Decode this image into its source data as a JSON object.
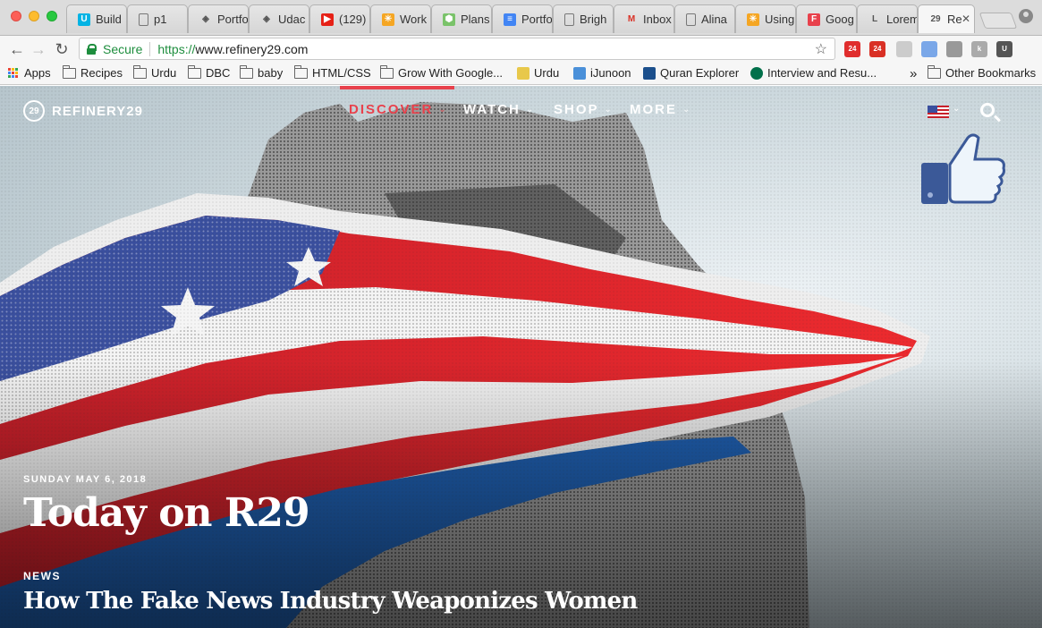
{
  "browser": {
    "tabs": [
      {
        "title": "Build",
        "icon": "udacity-icon",
        "color": "#02b3e4",
        "glyph": "U"
      },
      {
        "title": "p1",
        "icon": "page-icon",
        "color": "#ffffff",
        "glyph": ""
      },
      {
        "title": "Portfo",
        "icon": "codepen-icon",
        "color": "#ffffff",
        "glyph": "◈"
      },
      {
        "title": "Udac",
        "icon": "codepen-icon",
        "color": "#ffffff",
        "glyph": "◈"
      },
      {
        "title": "(129)",
        "icon": "youtube-icon",
        "color": "#e62117",
        "glyph": "▶"
      },
      {
        "title": "Work",
        "icon": "asterisk-icon",
        "color": "#f5a623",
        "glyph": "✳"
      },
      {
        "title": "Plans",
        "icon": "cube-icon",
        "color": "#7ac36a",
        "glyph": "⬢"
      },
      {
        "title": "Portfo",
        "icon": "docs-icon",
        "color": "#4285f4",
        "glyph": "≡"
      },
      {
        "title": "Brigh",
        "icon": "page-icon",
        "color": "#ffffff",
        "glyph": ""
      },
      {
        "title": "Inbox",
        "icon": "gmail-icon",
        "color": "#ffffff",
        "glyph": "M"
      },
      {
        "title": "Alina",
        "icon": "page-icon",
        "color": "#ffffff",
        "glyph": ""
      },
      {
        "title": "Using",
        "icon": "asterisk-icon",
        "color": "#f5a623",
        "glyph": "✳"
      },
      {
        "title": "Goog",
        "icon": "f-icon",
        "color": "#e8414c",
        "glyph": "F"
      },
      {
        "title": "Lorem",
        "icon": "l-icon",
        "color": "#ffffff",
        "glyph": "L"
      },
      {
        "title": "Re",
        "icon": "r29-icon",
        "color": "#ffffff",
        "glyph": "29",
        "active": true
      }
    ],
    "close_glyph": "✕",
    "back_glyph": "←",
    "forward_glyph": "→",
    "reload_glyph": "↻",
    "secure_label": "Secure",
    "url_scheme": "https://",
    "url_rest": "www.refinery29.com",
    "star_glyph": "☆",
    "extensions": [
      {
        "icon": "pinterest-badge-icon",
        "color": "#e02d2d",
        "badge": "24"
      },
      {
        "icon": "adblock-badge-icon",
        "color": "#d93025",
        "badge": "24"
      },
      {
        "icon": "feather-icon",
        "color": "#cccccc",
        "badge": ""
      },
      {
        "icon": "docs-ext-icon",
        "color": "#7aa7e8",
        "badge": ""
      },
      {
        "icon": "barcode-icon",
        "color": "#999999",
        "badge": ""
      },
      {
        "icon": "k-ext-icon",
        "color": "#aaaaaa",
        "badge": "k"
      },
      {
        "icon": "udacity-ext-icon",
        "color": "#555555",
        "badge": "U"
      }
    ]
  },
  "bookmarks": {
    "apps_label": "Apps",
    "items": [
      {
        "label": "Recipes",
        "icon": "folder-icon"
      },
      {
        "label": "Urdu",
        "icon": "folder-icon"
      },
      {
        "label": "DBC",
        "icon": "folder-icon"
      },
      {
        "label": "baby",
        "icon": "folder-icon"
      },
      {
        "label": "HTML/CSS",
        "icon": "folder-icon"
      },
      {
        "label": "Grow With Google...",
        "icon": "folder-icon"
      },
      {
        "label": "Urdu",
        "icon": "pen-icon"
      },
      {
        "label": "iJunoon",
        "icon": "ijunoon-icon"
      },
      {
        "label": "Quran Explorer",
        "icon": "quran-icon"
      },
      {
        "label": "Interview and Resu...",
        "icon": "starbucks-icon"
      }
    ],
    "overflow_glyph": "»",
    "other_label": "Other Bookmarks"
  },
  "site": {
    "logo_mark": "29",
    "logo_text": "REFINERY29",
    "nav": [
      {
        "label": "DISCOVER",
        "active": true
      },
      {
        "label": "WATCH",
        "active": false
      },
      {
        "label": "SHOP",
        "active": false
      },
      {
        "label": "MORE",
        "active": false
      }
    ],
    "nav_chevron": "⌄",
    "accent_color": "#e8414c",
    "locale_flag": "us-flag-icon",
    "date": "SUNDAY MAY 6, 2018",
    "headline": "Today on R29",
    "category": "NEWS",
    "story_title": "How The Fake News Industry Weaponizes Women"
  }
}
